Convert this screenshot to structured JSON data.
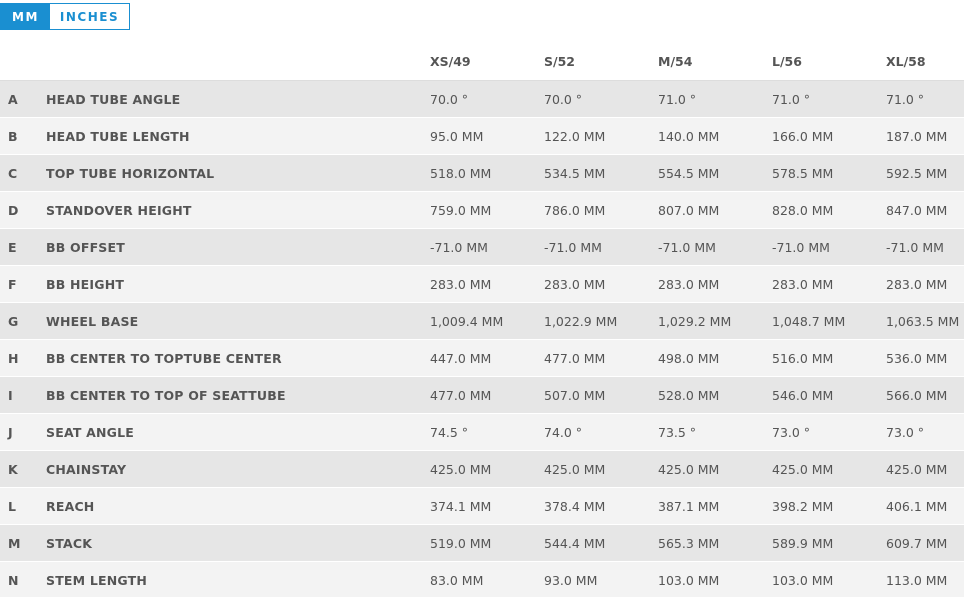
{
  "units": {
    "mm_label": "MM",
    "inches_label": "INCHES",
    "selected": "MM"
  },
  "sizes": [
    "XS/49",
    "S/52",
    "M/54",
    "L/56",
    "XL/58"
  ],
  "rows": [
    {
      "letter": "A",
      "name": "HEAD TUBE ANGLE",
      "values": [
        "70.0 °",
        "70.0 °",
        "71.0 °",
        "71.0 °",
        "71.0 °"
      ]
    },
    {
      "letter": "B",
      "name": "HEAD TUBE LENGTH",
      "values": [
        "95.0 MM",
        "122.0 MM",
        "140.0 MM",
        "166.0 MM",
        "187.0 MM"
      ]
    },
    {
      "letter": "C",
      "name": "TOP TUBE HORIZONTAL",
      "values": [
        "518.0 MM",
        "534.5 MM",
        "554.5 MM",
        "578.5 MM",
        "592.5 MM"
      ]
    },
    {
      "letter": "D",
      "name": "STANDOVER HEIGHT",
      "values": [
        "759.0 MM",
        "786.0 MM",
        "807.0 MM",
        "828.0 MM",
        "847.0 MM"
      ]
    },
    {
      "letter": "E",
      "name": "BB OFFSET",
      "values": [
        "-71.0 MM",
        "-71.0 MM",
        "-71.0 MM",
        "-71.0 MM",
        "-71.0 MM"
      ]
    },
    {
      "letter": "F",
      "name": "BB HEIGHT",
      "values": [
        "283.0 MM",
        "283.0 MM",
        "283.0 MM",
        "283.0 MM",
        "283.0 MM"
      ]
    },
    {
      "letter": "G",
      "name": "WHEEL BASE",
      "values": [
        "1,009.4 MM",
        "1,022.9 MM",
        "1,029.2 MM",
        "1,048.7 MM",
        "1,063.5 MM"
      ]
    },
    {
      "letter": "H",
      "name": "BB CENTER TO TOPTUBE CENTER",
      "values": [
        "447.0 MM",
        "477.0 MM",
        "498.0 MM",
        "516.0 MM",
        "536.0 MM"
      ]
    },
    {
      "letter": "I",
      "name": "BB CENTER TO TOP OF SEATTUBE",
      "values": [
        "477.0 MM",
        "507.0 MM",
        "528.0 MM",
        "546.0 MM",
        "566.0 MM"
      ]
    },
    {
      "letter": "J",
      "name": "SEAT ANGLE",
      "values": [
        "74.5 °",
        "74.0 °",
        "73.5 °",
        "73.0 °",
        "73.0 °"
      ]
    },
    {
      "letter": "K",
      "name": "CHAINSTAY",
      "values": [
        "425.0 MM",
        "425.0 MM",
        "425.0 MM",
        "425.0 MM",
        "425.0 MM"
      ]
    },
    {
      "letter": "L",
      "name": "REACH",
      "values": [
        "374.1 MM",
        "378.4 MM",
        "387.1 MM",
        "398.2 MM",
        "406.1 MM"
      ]
    },
    {
      "letter": "M",
      "name": "STACK",
      "values": [
        "519.0 MM",
        "544.4 MM",
        "565.3 MM",
        "589.9 MM",
        "609.7 MM"
      ]
    },
    {
      "letter": "N",
      "name": "STEM LENGTH",
      "values": [
        "83.0 MM",
        "93.0 MM",
        "103.0 MM",
        "103.0 MM",
        "113.0 MM"
      ]
    }
  ],
  "colors": {
    "accent": "#1a8fd1",
    "row_odd": "#e6e6e6",
    "row_even": "#f3f3f3",
    "text": "#555555"
  }
}
